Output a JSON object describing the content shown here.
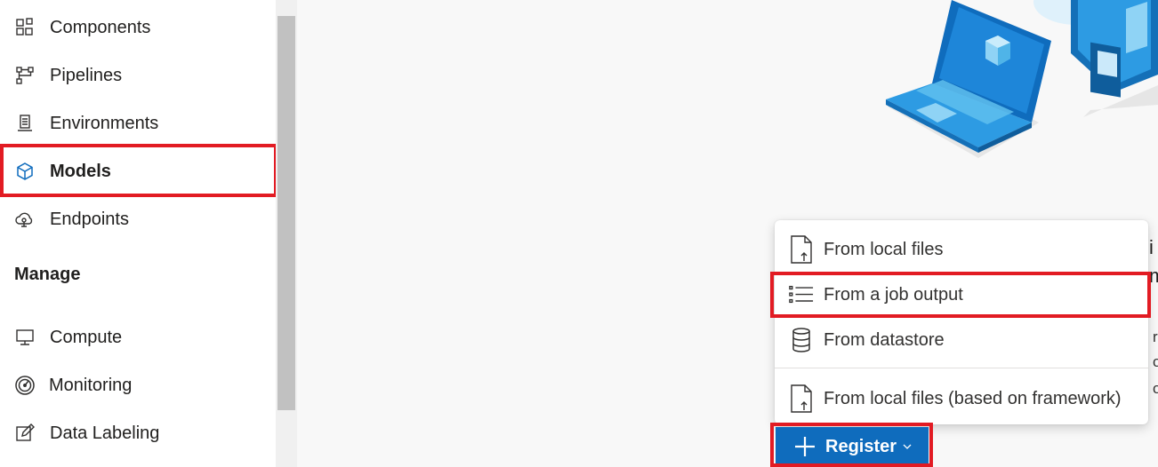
{
  "sidebar": {
    "items": [
      {
        "label": "Components",
        "icon": "components-icon"
      },
      {
        "label": "Pipelines",
        "icon": "pipelines-icon"
      },
      {
        "label": "Environments",
        "icon": "environments-icon"
      },
      {
        "label": "Models",
        "icon": "models-icon",
        "selected": true
      },
      {
        "label": "Endpoints",
        "icon": "endpoints-icon"
      }
    ],
    "manage_heading": "Manage",
    "manage_items": [
      {
        "label": "Compute",
        "icon": "compute-icon"
      },
      {
        "label": "Monitoring",
        "icon": "monitoring-icon"
      },
      {
        "label": "Data Labeling",
        "icon": "data-labeling-icon"
      }
    ]
  },
  "main": {
    "edge_text": {
      "line1": "i",
      "line2": "m",
      "line3": "r",
      "line4": "o",
      "line5": "o"
    }
  },
  "register_menu": {
    "items": [
      {
        "label": "From local files",
        "icon": "file-upload-icon"
      },
      {
        "label": "From a job output",
        "icon": "list-icon"
      },
      {
        "label": "From datastore",
        "icon": "database-icon"
      },
      {
        "label": "From local files (based on framework)",
        "icon": "file-upload-icon"
      }
    ]
  },
  "register_button": {
    "label": "Register",
    "icon": "plus-icon"
  },
  "colors": {
    "accent": "#0f6cbd",
    "highlight": "#e21b23"
  }
}
